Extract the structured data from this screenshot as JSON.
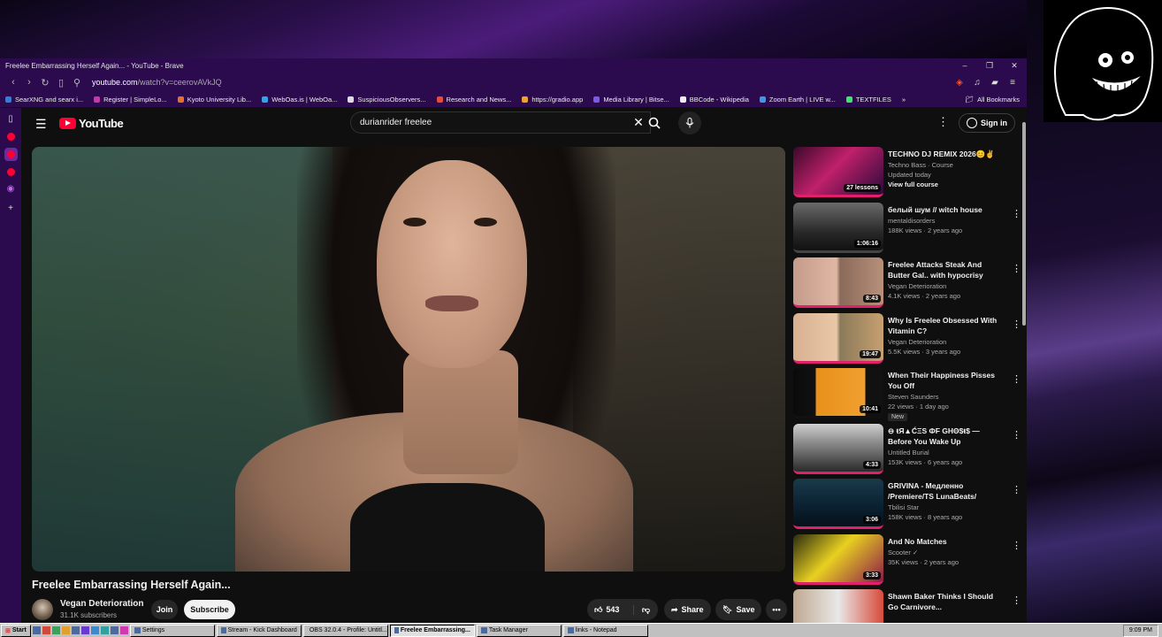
{
  "browser": {
    "window_title": "Freelee Embarrassing Herself Again... - YouTube - Brave",
    "url_host": "youtube.com",
    "url_path": "/watch?v=ceerovAVkJQ",
    "minimize": "–",
    "maximize": "❐",
    "close": "✕",
    "bookmarks": [
      {
        "label": "SearXNG and searx i...",
        "color": "#3a7bd5"
      },
      {
        "label": "Register | SimpleLo...",
        "color": "#c13aa8"
      },
      {
        "label": "Kyoto University Lib...",
        "color": "#e8702a"
      },
      {
        "label": "WebOas.is | WebOa...",
        "color": "#3aa0e8"
      },
      {
        "label": "SuspiciousObservers...",
        "color": "#dddddd"
      },
      {
        "label": "Research and News...",
        "color": "#e84a3a"
      },
      {
        "label": "https://gradio.app",
        "color": "#f0a030"
      },
      {
        "label": "Media Library | Bitse...",
        "color": "#7a5ae8"
      },
      {
        "label": "BBCode - Wikipedia",
        "color": "#eeeeee"
      },
      {
        "label": "Zoom Earth | LIVE w...",
        "color": "#3a9ae8"
      },
      {
        "label": "TEXTFILES",
        "color": "#3ae86a"
      }
    ],
    "all_bookmarks": "All Bookmarks"
  },
  "youtube": {
    "logo_text": "YouTube",
    "search_query": "durianrider freelee",
    "signin_label": "Sign in",
    "video_title": "Freelee Embarrassing Herself Again...",
    "channel_name": "Vegan Deterioration",
    "subscribers": "31.1K subscribers",
    "join_label": "Join",
    "subscribe_label": "Subscribe",
    "likes": "543",
    "share_label": "Share",
    "save_label": "Save"
  },
  "recommendations": [
    {
      "title": "TECHNO DJ REMIX 2026😊✌",
      "channel": "Techno Bass · Course",
      "stats": "Updated today",
      "extra": "View full course",
      "duration": "27 lessons",
      "thumb": "linear-gradient(135deg,#3a0a2a 0%,#c0206a 45%,#2a0a3a 100%)",
      "accent": "#e0206a"
    },
    {
      "title": "белый шум // witch house",
      "channel": "mentaldisorders",
      "stats": "188K views · 2 years ago",
      "duration": "1:06:16",
      "thumb": "linear-gradient(180deg,#6a6a6a 0%,#2a2a2a 60%,#111 100%)",
      "accent": "#444"
    },
    {
      "title": "Freelee Attacks Steak And Butter Gal.. with hypocrisy",
      "channel": "Vegan Deterioration",
      "stats": "4.1K views · 2 years ago",
      "duration": "8:43",
      "thumb": "linear-gradient(90deg,#c49a8a 0%,#e0b8a4 48%,#8a6a5a 52%,#b8907a 100%)",
      "accent": "#e0206a"
    },
    {
      "title": "Why Is Freelee Obsessed With Vitamin C?",
      "channel": "Vegan Deterioration",
      "stats": "5.5K views · 3 years ago",
      "duration": "19:47",
      "thumb": "linear-gradient(90deg,#d8b090 0%,#e8c8a8 48%,#8a7a5a 52%,#c8a070 100%)",
      "accent": "#e0206a"
    },
    {
      "title": "When Their Happiness Pisses You Off",
      "channel": "Steven Saunders",
      "stats": "22 views · 1 day ago",
      "badge": "New",
      "duration": "10:41",
      "thumb": "linear-gradient(90deg,#0a0a0a 0%,#111 25%,#e8901a 25%,#f0a030 80%,#111 80%)",
      "accent": "#111"
    },
    {
      "title": "⊖ ŧЯ▲ĆΞS ФF GHΘ$ŧ$ — Before You Wake Up",
      "channel": "Untitled Burial",
      "stats": "153K views · 6 years ago",
      "duration": "4:33",
      "thumb": "linear-gradient(180deg,#d0d0d0 0%,#8a8a8a 40%,#2a2a2a 100%)",
      "accent": "#e0206a"
    },
    {
      "title": "GRIVINA - Медленно /Premiere/TS LunaBeats/",
      "channel": "Tbilisi Star",
      "stats": "158K views · 8 years ago",
      "duration": "3:06",
      "thumb": "linear-gradient(180deg,#1a3a4a 0%,#0a2030 60%,#061018 100%)",
      "accent": "#e0206a"
    },
    {
      "title": "And No Matches",
      "channel": "Scooter ✓",
      "stats": "35K views · 2 years ago",
      "duration": "3:33",
      "thumb": "linear-gradient(135deg,#2a2a10 0%,#e8d020 45%,#8a1a4a 100%)",
      "accent": "#e0206a"
    },
    {
      "title": "Shawn Baker Thinks I Should Go Carnivore...",
      "channel": "",
      "stats": "",
      "duration": "",
      "thumb": "linear-gradient(90deg,#c0a890 0%,#e8e8e8 50%,#d84a3a 100%)",
      "accent": "#e0206a"
    }
  ],
  "taskbar": {
    "start_label": "Start",
    "tasks": [
      {
        "label": "Settings",
        "active": false
      },
      {
        "label": "Stream - Kick Dashboard",
        "active": false
      },
      {
        "label": "OBS 32.0.4 - Profile: Untitl...",
        "active": false
      },
      {
        "label": "Freelee Embarrassing...",
        "active": true
      },
      {
        "label": "Task Manager",
        "active": false
      },
      {
        "label": "links - Notepad",
        "active": false
      }
    ],
    "clock": "9:09 PM"
  }
}
